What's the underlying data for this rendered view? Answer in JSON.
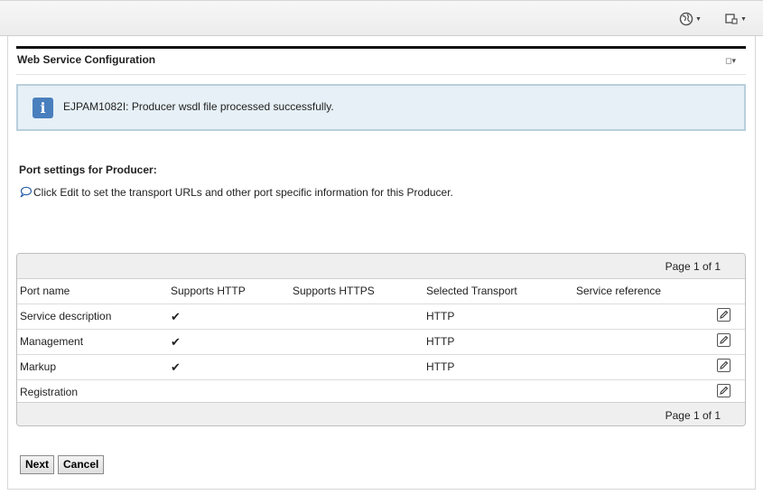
{
  "topbar": {
    "globe_icon": "globe-icon",
    "window_icon": "window-icon"
  },
  "portlet": {
    "title": "Web Service Configuration"
  },
  "message": {
    "icon": "info-icon",
    "text": "EJPAM1082I: Producer wsdl file processed successfully."
  },
  "section": {
    "title": "Port settings for Producer:",
    "hint": "Click Edit to set the transport URLs and other port specific information for this Producer."
  },
  "table": {
    "page_label_top": "Page 1 of 1",
    "page_label_bottom": "Page 1 of 1",
    "columns": [
      "Port name",
      "Supports HTTP",
      "Supports HTTPS",
      "Selected Transport",
      "Service reference"
    ],
    "rows": [
      {
        "port": "Service description",
        "http": "✔",
        "https": "",
        "transport": "HTTP",
        "reference": ""
      },
      {
        "port": "Management",
        "http": "✔",
        "https": "",
        "transport": "HTTP",
        "reference": ""
      },
      {
        "port": "Markup",
        "http": "✔",
        "https": "",
        "transport": "HTTP",
        "reference": ""
      },
      {
        "port": "Registration",
        "http": "",
        "https": "",
        "transport": "",
        "reference": ""
      }
    ]
  },
  "buttons": {
    "next": "Next",
    "cancel": "Cancel"
  }
}
